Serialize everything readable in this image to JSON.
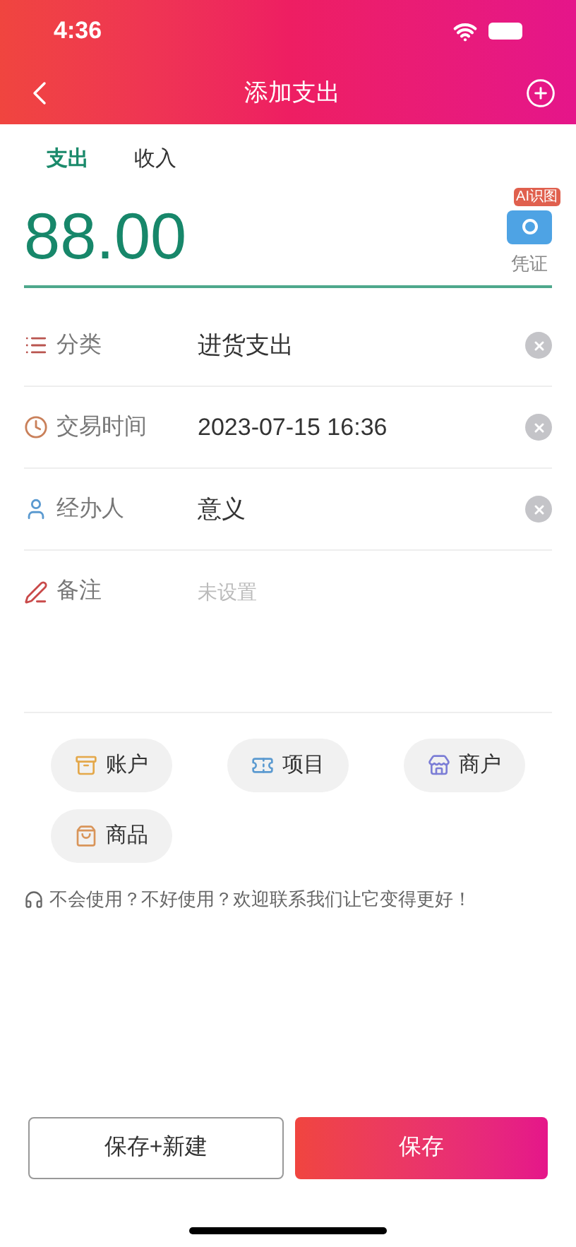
{
  "status_bar": {
    "time": "4:36"
  },
  "nav": {
    "title": "添加支出"
  },
  "tabs": [
    {
      "label": "支出",
      "selected": true
    },
    {
      "label": "收入",
      "selected": false
    }
  ],
  "amount": {
    "value": "88.00",
    "voucher_badge": "AI识图",
    "voucher_label": "凭证"
  },
  "fields": [
    {
      "kind": "category",
      "label": "分类",
      "value": "进货支出",
      "clearable": true
    },
    {
      "kind": "time",
      "label": "交易时间",
      "value": "2023-07-15 16:36",
      "clearable": true
    },
    {
      "kind": "person",
      "label": "经办人",
      "value": "意义",
      "clearable": true
    },
    {
      "kind": "note",
      "label": "备注",
      "placeholder": "未设置",
      "clearable": false
    }
  ],
  "chips": [
    {
      "kind": "account",
      "label": "账户"
    },
    {
      "kind": "project",
      "label": "项目"
    },
    {
      "kind": "merchant",
      "label": "商户"
    },
    {
      "kind": "goods",
      "label": "商品"
    }
  ],
  "help": "不会使用？不好使用？欢迎联系我们让它变得更好！",
  "buttons": {
    "secondary": "保存+新建",
    "primary": "保存"
  }
}
